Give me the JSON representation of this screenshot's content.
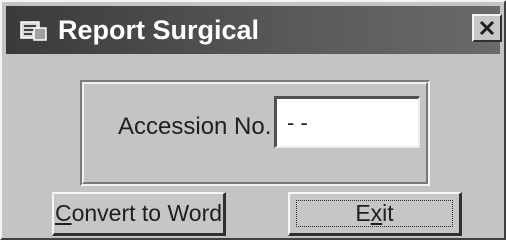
{
  "window": {
    "title": "Report Surgical",
    "title_icon": "report-form-icon",
    "close_glyph": "×"
  },
  "form": {
    "accession_label": "Accession No.",
    "accession_value": "- -"
  },
  "buttons": {
    "convert": {
      "mnemonic": "C",
      "rest": "onvert to Word"
    },
    "exit": {
      "before": "E",
      "mnemonic": "x",
      "after": "it"
    }
  },
  "colors": {
    "titlebar": "#4a4a4a",
    "face": "#c4c4c4"
  }
}
